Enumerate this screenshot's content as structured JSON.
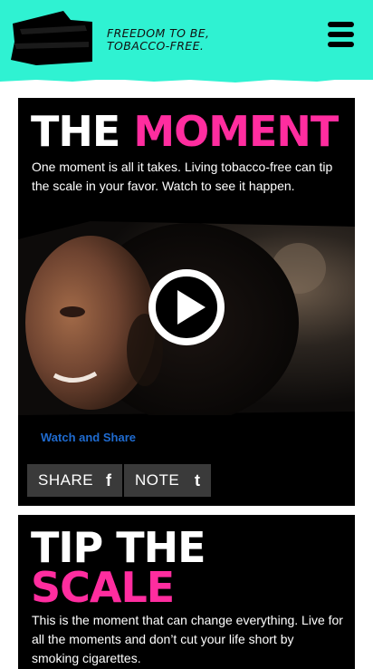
{
  "header": {
    "tagline_line1": "FREEDOM TO BE,",
    "tagline_line2": "TOBACCO-FREE.",
    "logo_icon": "brand-logo-icon",
    "menu_icon": "hamburger-menu-icon",
    "background_color": "#2ff2d2"
  },
  "moment_card": {
    "title_white": "THE",
    "title_pink": "MOMENT",
    "description": "One moment is all it takes. Living tobacco-free can tip the scale in your favor. Watch to see it happen.",
    "video_icon": "play-icon",
    "watch_link": "Watch and Share",
    "share_label": "SHARE",
    "share_icon": "f",
    "share_icon_name": "facebook-icon",
    "note_label": "NOTE",
    "note_icon": "t",
    "note_icon_name": "tumblr-icon"
  },
  "scale_card": {
    "title_line1": "TIP THE",
    "title_line2": "SCALE",
    "description": "This is the moment that can change everything. Live for all the moments and don’t cut your life short by smoking cigarettes."
  },
  "colors": {
    "accent_pink": "#ff2d9f",
    "header_teal": "#2ff2d2",
    "link_blue": "#1f6bd0",
    "card_black": "#000000"
  }
}
